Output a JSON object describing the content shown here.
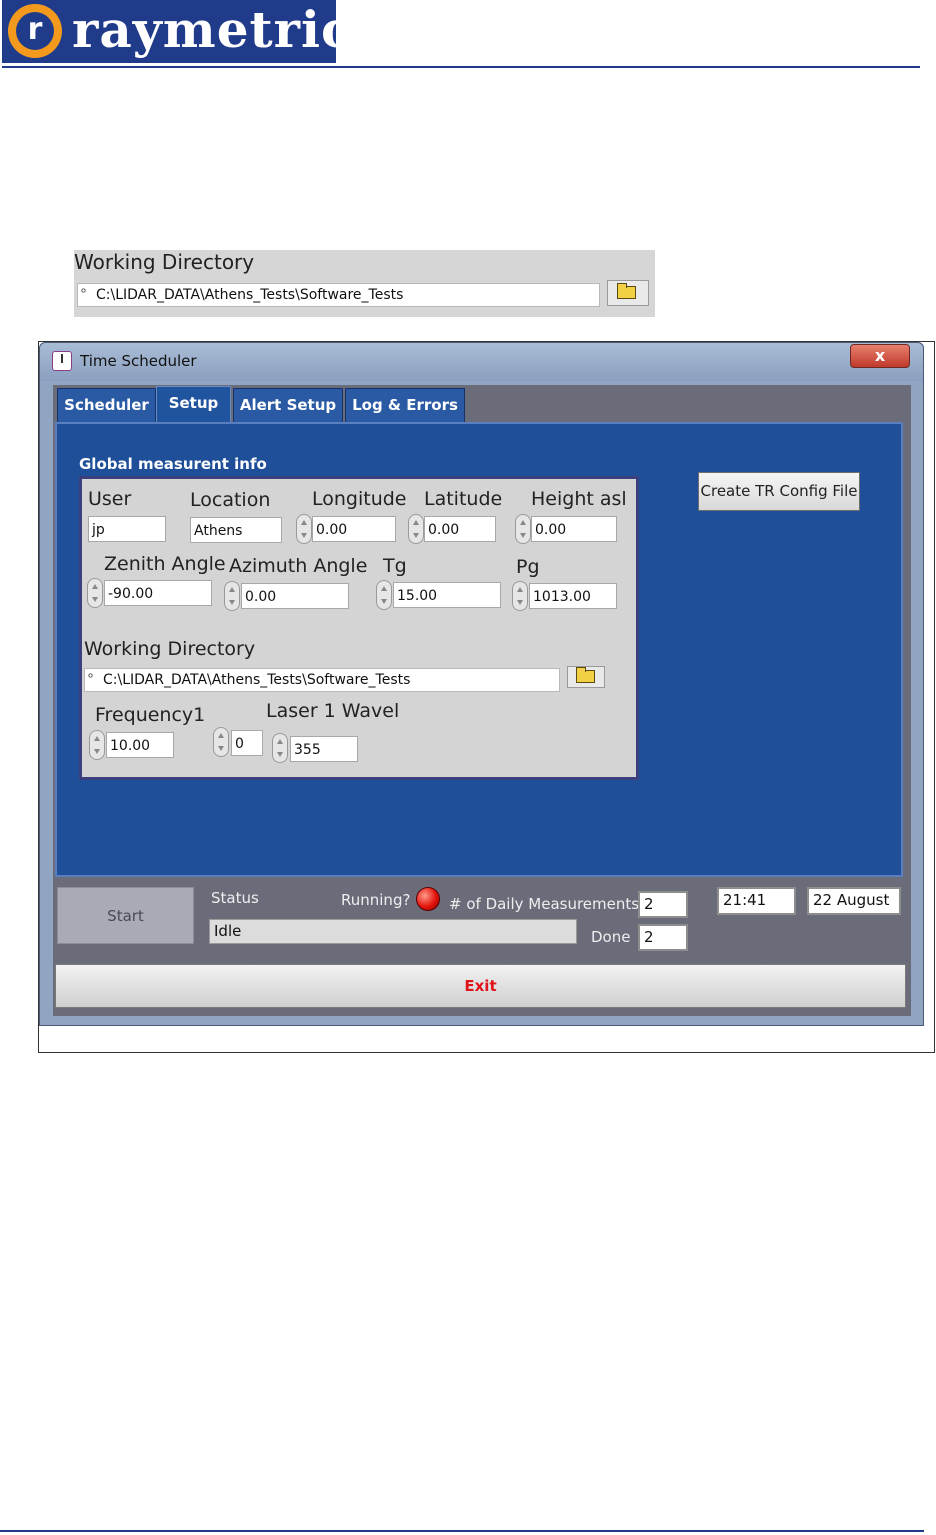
{
  "logo": {
    "letter": "r",
    "brand": "raymetrics"
  },
  "snippet": {
    "label": "Working Directory",
    "path": "C:\\LIDAR_DATA\\Athens_Tests\\Software_Tests"
  },
  "window": {
    "title": "Time Scheduler",
    "close": "x",
    "tabs": [
      "Scheduler",
      "Setup",
      "Alert Setup",
      "Log & Errors"
    ],
    "active_tab": "Setup"
  },
  "setup": {
    "section_title": "Global measurent info",
    "create_button": "Create TR Config File",
    "user": {
      "label": "User",
      "value": "jp"
    },
    "location": {
      "label": "Location",
      "value": "Athens"
    },
    "longitude": {
      "label": "Longitude",
      "value": "0.00"
    },
    "latitude": {
      "label": "Latitude",
      "value": "0.00"
    },
    "height": {
      "label": "Height asl",
      "value": "0.00"
    },
    "zenith": {
      "label": "Zenith Angle",
      "value": "-90.00"
    },
    "azimuth": {
      "label": "Azimuth Angle",
      "value": "0.00"
    },
    "tg": {
      "label": "Tg",
      "value": "15.00"
    },
    "pg": {
      "label": "Pg",
      "value": "1013.00"
    },
    "working_dir": {
      "label": "Working Directory",
      "value": "C:\\LIDAR_DATA\\Athens_Tests\\Software_Tests"
    },
    "frequency": {
      "label": "Frequency1",
      "value": "10.00"
    },
    "index": {
      "value": "0"
    },
    "laser": {
      "label": "Laser  1 Wavel",
      "value": "355"
    }
  },
  "bottom": {
    "start": "Start",
    "status_label": "Status",
    "status_value": "Idle",
    "running_label": "Running?",
    "daily_label": "# of Daily Measurements",
    "daily_value": "2",
    "done_label": "Done",
    "done_value": "2",
    "time": "21:41",
    "date": "22 August",
    "exit": "Exit"
  },
  "colors": {
    "led": "#e4140c",
    "exit_text": "#e0141b",
    "panel": "#1e4f98"
  }
}
